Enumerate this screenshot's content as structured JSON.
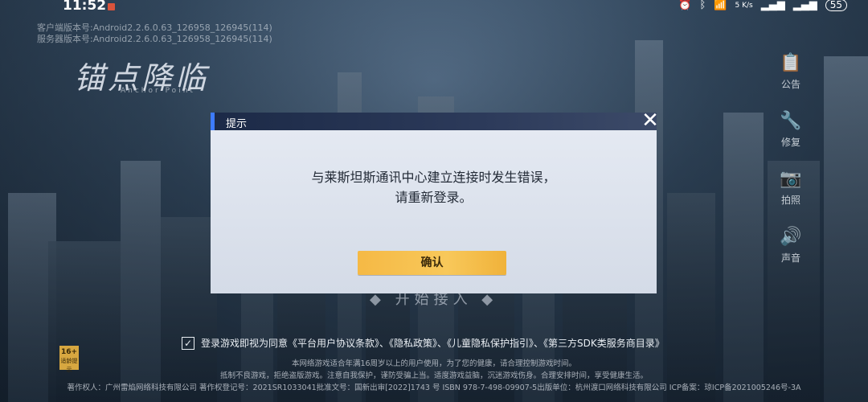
{
  "status_bar": {
    "time": "11:52",
    "net_speed": "5 K/s",
    "battery": "55"
  },
  "version": {
    "client": "客户端版本号:Android2.2.6.0.63_126958_126945(114)",
    "server": "服务器版本号:Android2.2.6.0.63_126958_126945(114)"
  },
  "logo": {
    "title": "锚点降临",
    "subtitle": "Anchor Point"
  },
  "side_menu": [
    {
      "icon": "notice-icon",
      "glyph": "📋",
      "label": "公告"
    },
    {
      "icon": "repair-icon",
      "glyph": "🔧",
      "label": "修复"
    },
    {
      "icon": "camera-icon",
      "glyph": "📷",
      "label": "拍照"
    },
    {
      "icon": "sound-icon",
      "glyph": "🔊",
      "label": "声音"
    }
  ],
  "start_text": "◆ 开始接入 ◆",
  "agreement": {
    "checked": true,
    "text": "登录游戏即视为同意《平台用户协议条款》、《隐私政策》、《儿童隐私保护指引》、《第三方SDK类服务商目录》"
  },
  "legal": {
    "line1": "本网络游戏适合年满16周岁以上的用户使用，为了您的健康，请合理控制游戏时间。",
    "line2": "抵制不良游戏，拒绝盗版游戏。注意自我保护，谨防受骗上当。适度游戏益脑，沉迷游戏伤身。合理安排时间，享受健康生活。",
    "line3": "著作权人：广州雷焰网络科技有限公司    著作权登记号：2021SR1033041批准文号：国新出审[2022]1743 号    ISBN 978-7-498-09907-5出版单位：杭州渡口网络科技有限公司    ICP备案：琼ICP备2021005246号-3A"
  },
  "age_badge": {
    "age": "16+",
    "label": "适龄提示"
  },
  "dialog": {
    "title": "提示",
    "close": "✕",
    "message_line1": "与莱斯坦斯通讯中心建立连接时发生错误，",
    "message_line2": "请重新登录。",
    "confirm_label": "确认"
  }
}
